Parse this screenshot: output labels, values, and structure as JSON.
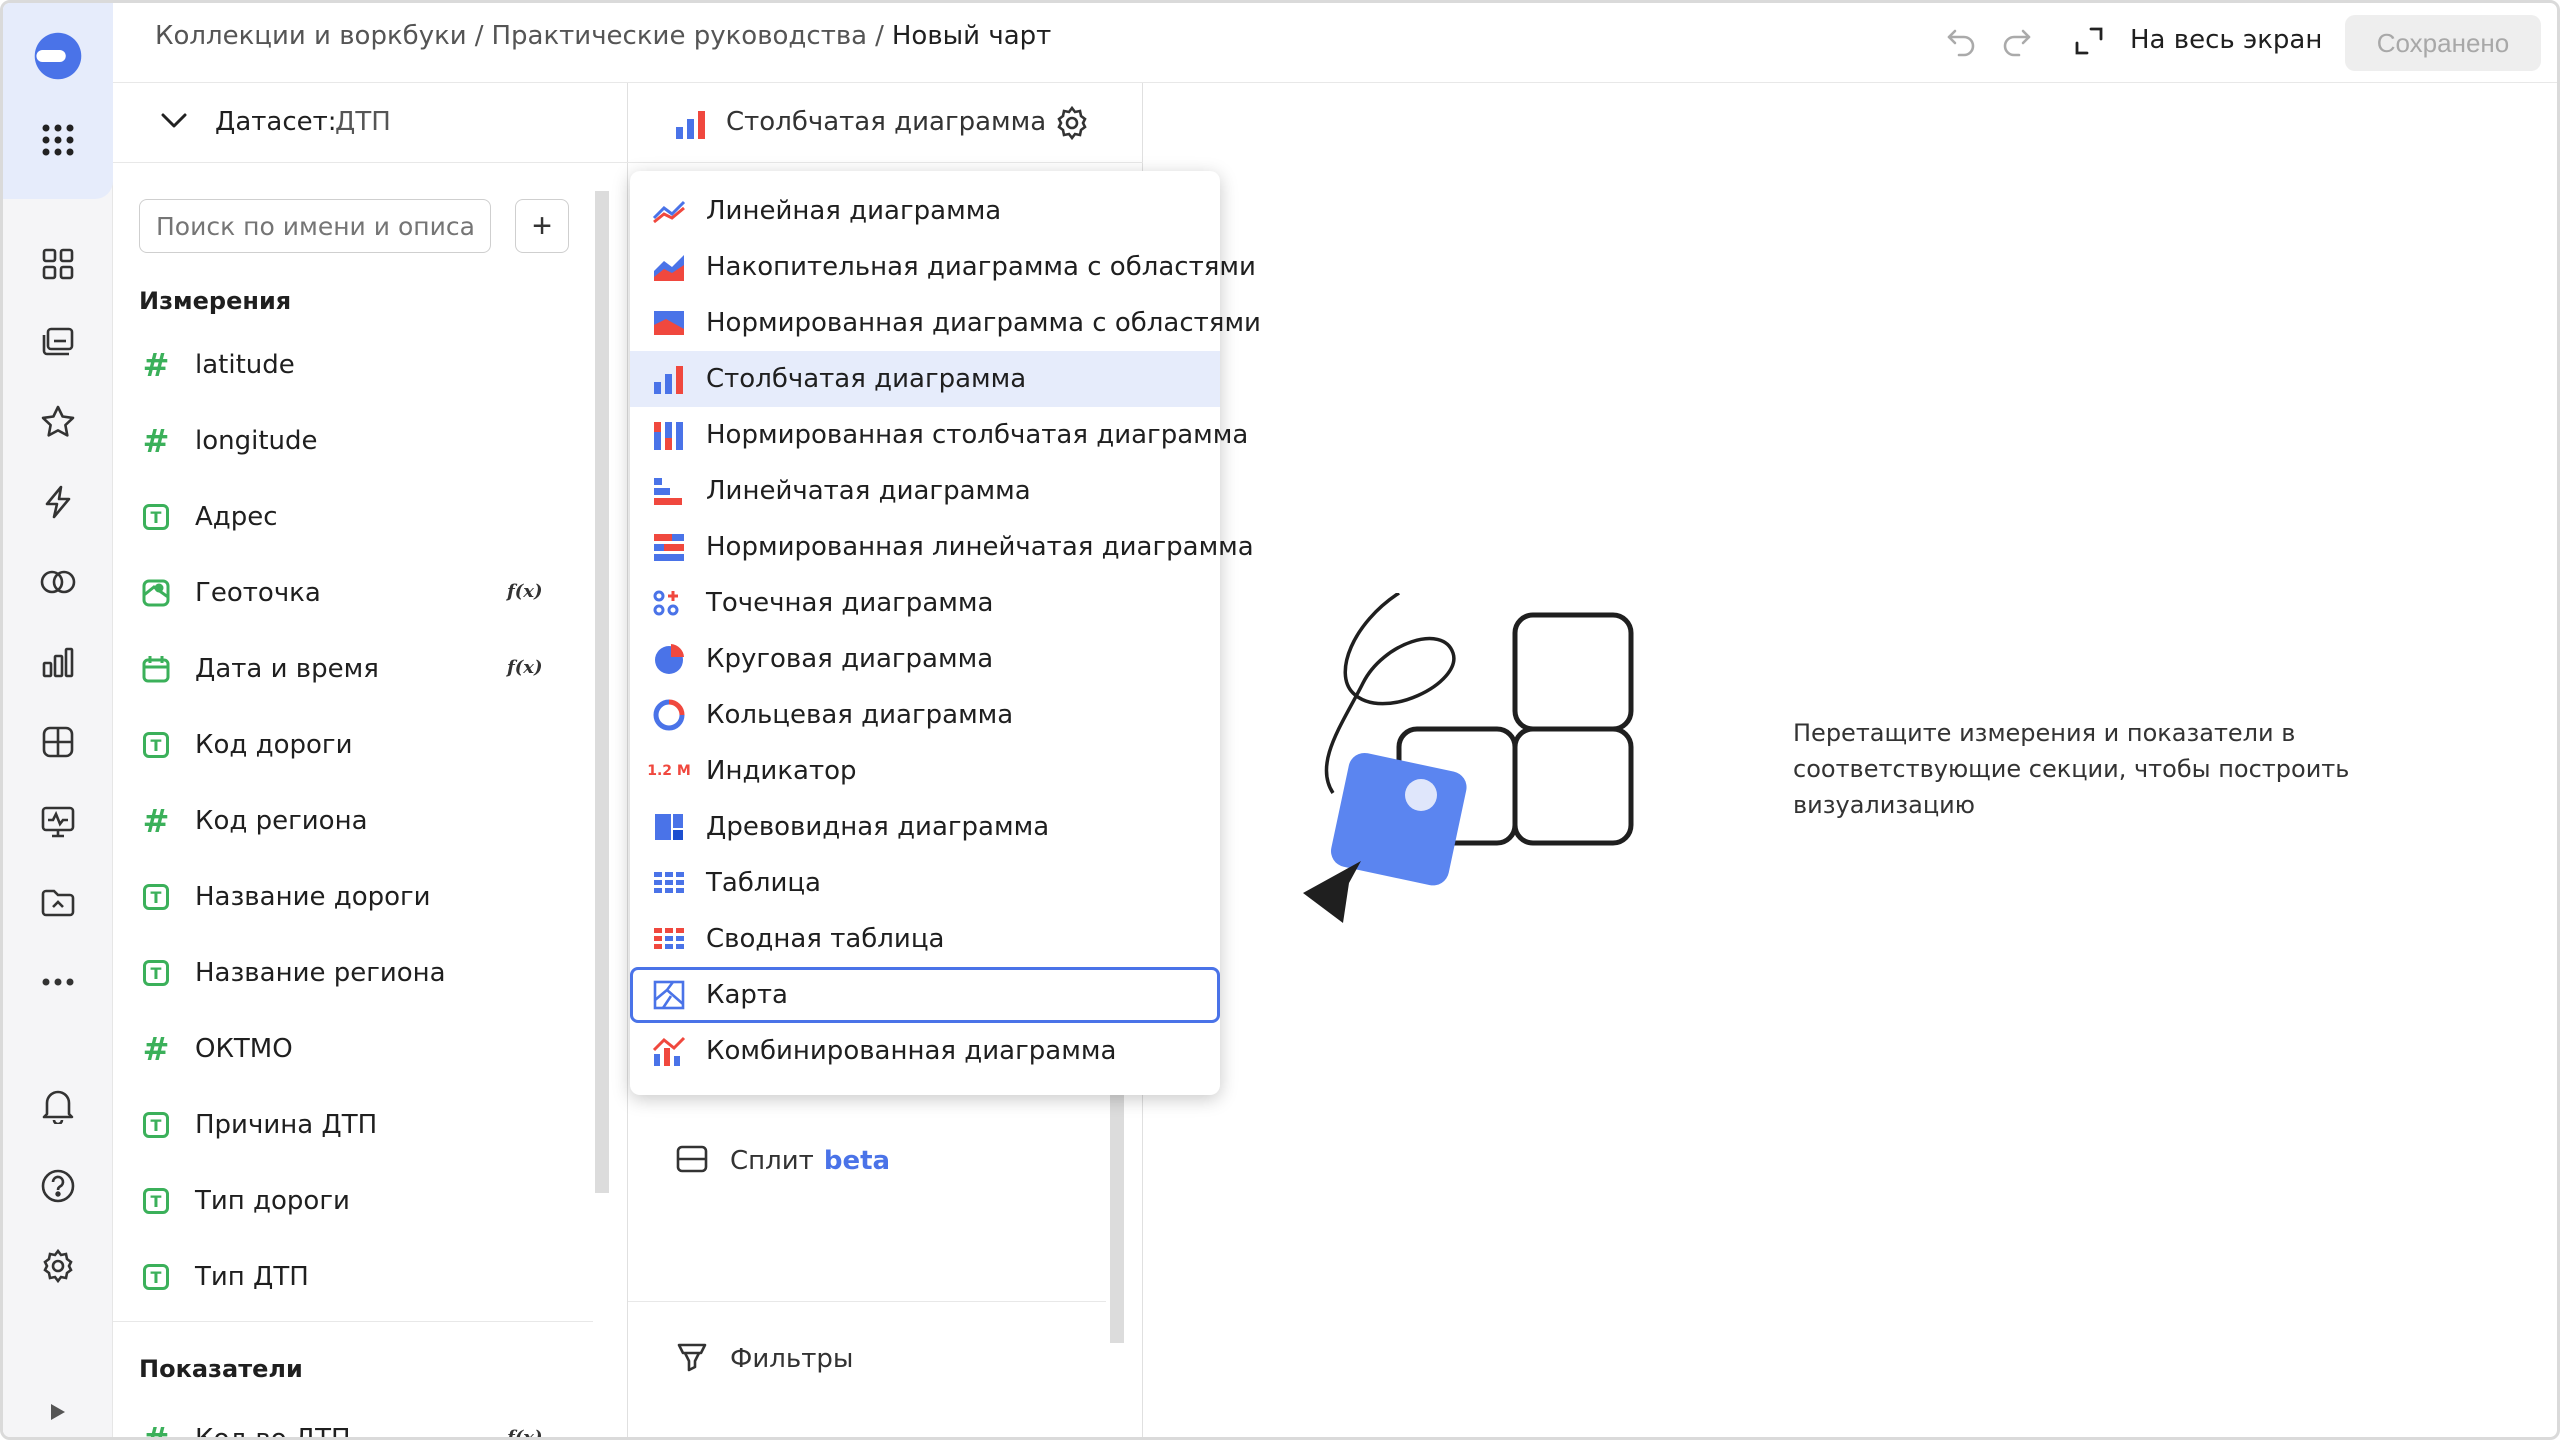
{
  "header": {
    "breadcrumb": [
      "Коллекции и воркбуки",
      "Практические руководства",
      "Новый чарт"
    ],
    "fullscreen_label": "На весь экран",
    "save_label": "Сохранено"
  },
  "rail": {
    "items": [
      "logo-icon",
      "apps-grid-icon",
      "dashboards-icon",
      "collections-icon",
      "favorites-icon",
      "quick-actions-icon",
      "connections-icon",
      "charts-icon",
      "datasets-icon",
      "monitoring-icon",
      "workbooks-icon",
      "more-icon",
      "notifications-icon",
      "help-icon",
      "settings-icon",
      "expand-icon"
    ]
  },
  "dataset": {
    "label": "Датасет:",
    "name": "ДТП",
    "search_placeholder": "Поиск по имени и описанию",
    "add_label": "+",
    "dimensions_title": "Измерения",
    "dimensions": [
      {
        "label": "latitude",
        "type": "number",
        "fx": ""
      },
      {
        "label": "longitude",
        "type": "number",
        "fx": ""
      },
      {
        "label": "Адрес",
        "type": "text",
        "fx": ""
      },
      {
        "label": "Геоточка",
        "type": "geo",
        "fx": "f(x)"
      },
      {
        "label": "Дата и время",
        "type": "date",
        "fx": "f(x)"
      },
      {
        "label": "Код дороги",
        "type": "text",
        "fx": ""
      },
      {
        "label": "Код региона",
        "type": "number",
        "fx": ""
      },
      {
        "label": "Название дороги",
        "type": "text",
        "fx": ""
      },
      {
        "label": "Название региона",
        "type": "text",
        "fx": ""
      },
      {
        "label": "ОКТМО",
        "type": "number",
        "fx": ""
      },
      {
        "label": "Причина ДТП",
        "type": "text",
        "fx": ""
      },
      {
        "label": "Тип дороги",
        "type": "text",
        "fx": ""
      },
      {
        "label": "Тип ДТП",
        "type": "text",
        "fx": ""
      }
    ],
    "measures_title": "Показатели",
    "measures": [
      {
        "label": "Кол-во ДТП",
        "type": "number",
        "fx": "f(x)"
      }
    ]
  },
  "viz": {
    "current_type": "Столбчатая диаграмма",
    "split_label": "Сплит",
    "split_badge": "beta",
    "filters_label": "Фильтры"
  },
  "chart_menu": {
    "selected": "Столбчатая диаграмма",
    "focused": "Карта",
    "items": [
      {
        "label": "Линейная диаграмма",
        "icon": "line-chart-icon"
      },
      {
        "label": "Накопительная диаграмма с областями",
        "icon": "area-chart-icon"
      },
      {
        "label": "Нормированная диаграмма с областями",
        "icon": "normalized-area-icon"
      },
      {
        "label": "Столбчатая диаграмма",
        "icon": "column-chart-icon"
      },
      {
        "label": "Нормированная столбчатая диаграмма",
        "icon": "normalized-column-icon"
      },
      {
        "label": "Линейчатая диаграмма",
        "icon": "bar-chart-icon"
      },
      {
        "label": "Нормированная линейчатая диаграмма",
        "icon": "normalized-bar-icon"
      },
      {
        "label": "Точечная диаграмма",
        "icon": "scatter-icon"
      },
      {
        "label": "Круговая диаграмма",
        "icon": "pie-icon"
      },
      {
        "label": "Кольцевая диаграмма",
        "icon": "donut-icon"
      },
      {
        "label": "Индикатор",
        "icon": "indicator-icon"
      },
      {
        "label": "Древовидная диаграмма",
        "icon": "treemap-icon"
      },
      {
        "label": "Таблица",
        "icon": "table-icon"
      },
      {
        "label": "Сводная таблица",
        "icon": "pivot-table-icon"
      },
      {
        "label": "Карта",
        "icon": "map-icon"
      },
      {
        "label": "Комбинированная диаграмма",
        "icon": "combined-chart-icon"
      }
    ],
    "indicator_icon_text": "1.2 M"
  },
  "canvas": {
    "empty_text": "Перетащите измерения и показатели в соответствующие секции, чтобы построить визуализацию"
  },
  "colors": {
    "accent": "#4a73e8",
    "selection": "#e6ecfb",
    "red": "#f0483e",
    "green": "#3bb05a"
  }
}
